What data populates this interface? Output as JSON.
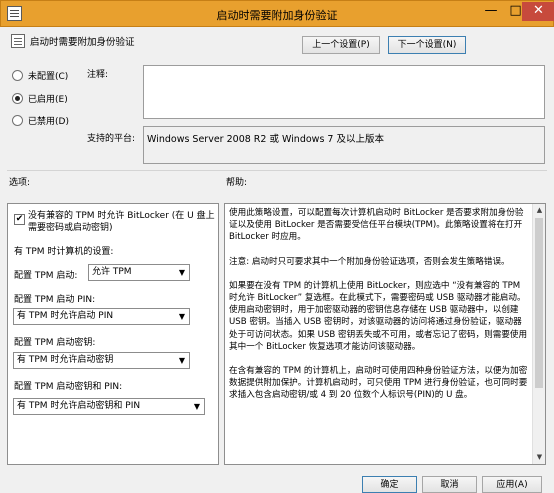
{
  "window": {
    "title": "启动时需要附加身份验证",
    "min": "—",
    "max": "□",
    "close": "✕"
  },
  "header": {
    "title": "启动时需要附加身份验证",
    "prev_button": "上一个设置(P)",
    "next_button": "下一个设置(N)"
  },
  "state": {
    "not_configured": "未配置(C)",
    "enabled": "已启用(E)",
    "disabled": "已禁用(D)",
    "selected": "enabled"
  },
  "comment": {
    "label": "注释:",
    "value": ""
  },
  "platform": {
    "label": "支持的平台:",
    "value": "Windows Server 2008 R2 或 Windows 7 及以上版本"
  },
  "options": {
    "label": "选项:",
    "allow_bitlocker_label": "没有兼容的 TPM 时允许 BitLocker (在 U 盘上需要密码或启动密钥)",
    "allow_bitlocker_checked": true,
    "tpm_computer_label": "有 TPM 时计算机的设置:",
    "tpm_startup_label": "配置 TPM 启动:",
    "tpm_startup_value": "允许 TPM",
    "tpm_pin_label": "配置 TPM 启动 PIN:",
    "tpm_pin_value": "有 TPM 时允许启动 PIN",
    "tpm_key_label": "配置 TPM 启动密钥:",
    "tpm_key_value": "有 TPM 时允许启动密钥",
    "tpm_key_pin_label": "配置 TPM 启动密钥和 PIN:",
    "tpm_key_pin_value": "有 TPM 时允许启动密钥和 PIN"
  },
  "help": {
    "label": "帮助:",
    "p1": "使用此策略设置，可以配置每次计算机启动时 BitLocker 是否要求附加身份验证以及使用 BitLocker 是否需要受信任平台模块(TPM)。此策略设置将在打开 BitLocker 时应用。",
    "p2": "注意: 启动时只可要求其中一个附加身份验证选项，否则会发生策略错误。",
    "p3": "如果要在没有 TPM 的计算机上使用 BitLocker，则应选中 “没有兼容的 TPM 时允许 BitLocker” 复选框。在此模式下，需要密码或 USB 驱动器才能启动。使用启动密钥时，用于加密驱动器的密钥信息存储在 USB 驱动器中，以创建 USB 密钥。当插入 USB 密钥时，对该驱动器的访问将通过身份验证，驱动器处于可访问状态。如果 USB 密钥丢失或不可用，或者忘记了密码，则需要使用其中一个 BitLocker 恢复选项才能访问该驱动器。",
    "p4": "在含有兼容的 TPM 的计算机上，启动时可使用四种身份验证方法，以便为加密数据提供附加保护。计算机启动时，可只使用 TPM 进行身份验证，也可同时要求插入包含启动密钥/或 4 到 20 位数个人标识号(PIN)的 U 盘。"
  },
  "footer": {
    "ok": "确定",
    "cancel": "取消",
    "apply": "应用(A)"
  }
}
